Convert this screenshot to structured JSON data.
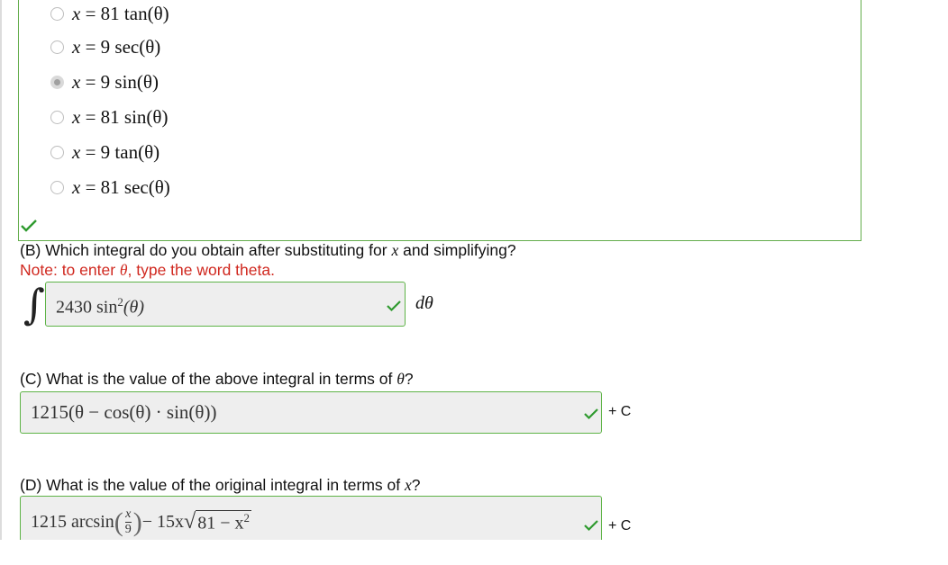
{
  "part_a": {
    "options": [
      {
        "lhs": "x",
        "eq": " = ",
        "rhs": "81 tan(θ)",
        "selected": false
      },
      {
        "lhs": "x",
        "eq": " = ",
        "rhs": "9 sec(θ)",
        "selected": false
      },
      {
        "lhs": "x",
        "eq": " = ",
        "rhs": "9 sin(θ)",
        "selected": true
      },
      {
        "lhs": "x",
        "eq": " = ",
        "rhs": "81 sin(θ)",
        "selected": false
      },
      {
        "lhs": "x",
        "eq": " = ",
        "rhs": "9 tan(θ)",
        "selected": false
      },
      {
        "lhs": "x",
        "eq": " = ",
        "rhs": "81 sec(θ)",
        "selected": false
      }
    ]
  },
  "part_b": {
    "question_prefix": "(B) Which integral do you obtain after substituting for ",
    "question_var": "x",
    "question_suffix": " and simplifying?",
    "note_prefix": "Note: to enter ",
    "note_var": "θ",
    "note_suffix": ", type the word theta.",
    "integral_sign": "∫",
    "answer_coeff": "2430 sin",
    "answer_exp": "2",
    "answer_arg": "(θ)",
    "differential": "dθ"
  },
  "part_c": {
    "question_prefix": "(C) What is the value of the above integral in terms of ",
    "question_var": "θ",
    "question_suffix": "?",
    "answer": "1215(θ − cos(θ) · sin(θ))",
    "plus_c": "+ C"
  },
  "part_d": {
    "question_prefix": "(D) What is the value of the original integral in terms of ",
    "question_var": "x",
    "question_suffix": "?",
    "answer_start": "1215 arcsin",
    "frac_num": "x",
    "frac_den": "9",
    "answer_mid": " − 15x",
    "radicand": "81 − x",
    "radicand_exp": "2",
    "plus_c": "+ C"
  },
  "colors": {
    "correct_border": "#5eb347",
    "check": "#2e9a2e",
    "note": "#d0281f",
    "answer_bg": "#eeeeee"
  }
}
